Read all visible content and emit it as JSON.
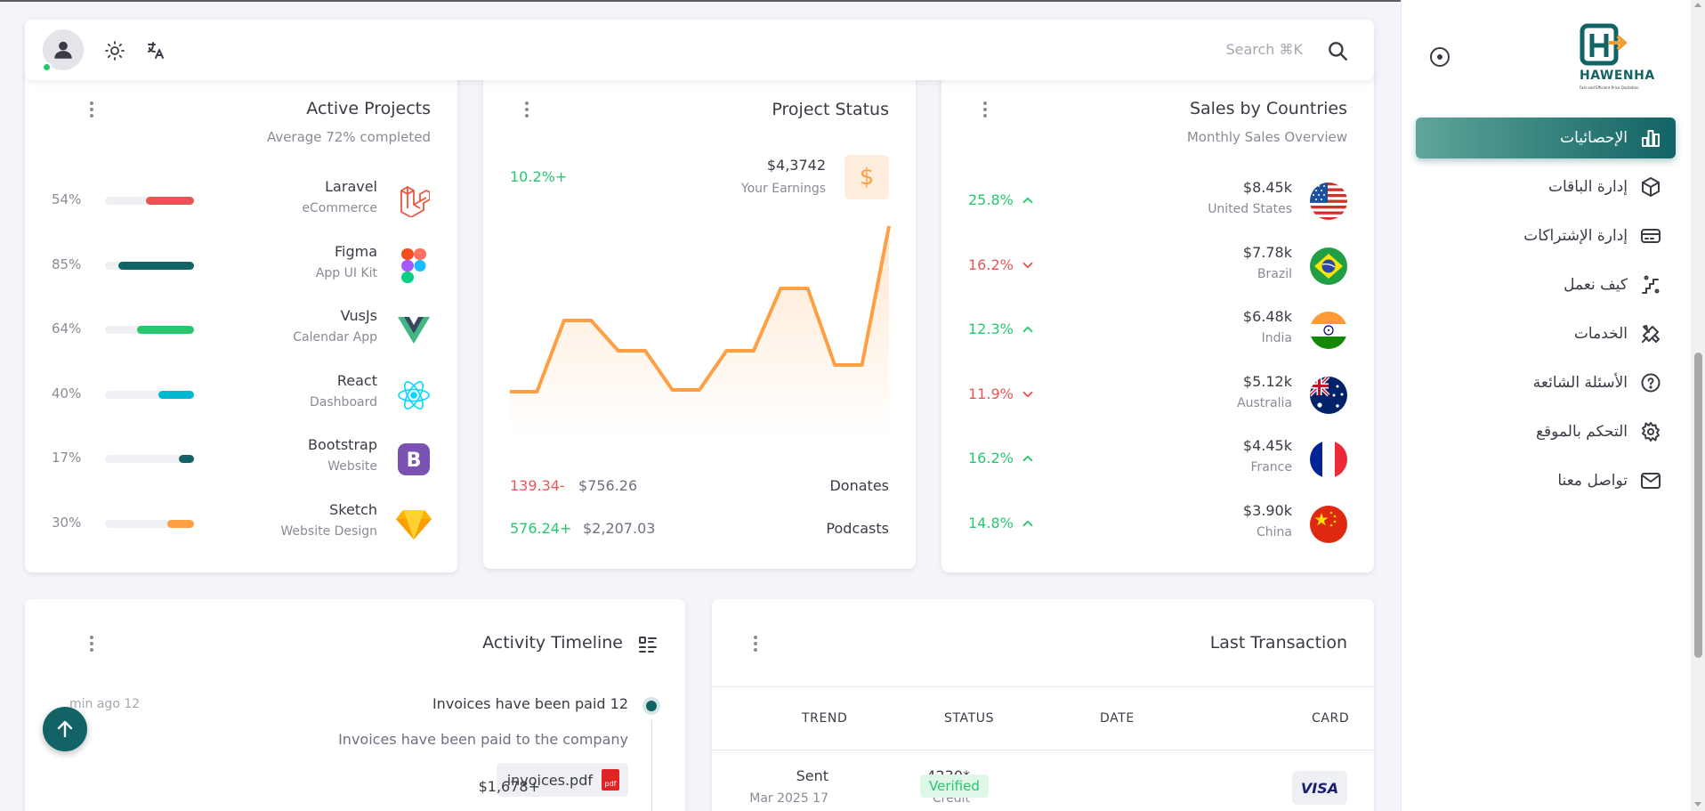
{
  "navbar": {
    "search_placeholder": "Search ⌘K",
    "icons": [
      "user-avatar",
      "sun-icon",
      "translate-icon",
      "search-icon"
    ]
  },
  "active_projects": {
    "title": "Active Projects",
    "subtitle": "Average 72% completed",
    "items": [
      {
        "name": "Laravel",
        "sub": "eCommerce",
        "pct": "54%",
        "progress": 0.54,
        "color": "#ea5455",
        "icon": "laravel-logo"
      },
      {
        "name": "Figma",
        "sub": "App UI Kit",
        "pct": "85%",
        "progress": 0.85,
        "color": "#126365",
        "icon": "figma-logo"
      },
      {
        "name": "VusJs",
        "sub": "Calendar App",
        "pct": "64%",
        "progress": 0.64,
        "color": "#28c76f",
        "icon": "vue-logo"
      },
      {
        "name": "React",
        "sub": "Dashboard",
        "pct": "40%",
        "progress": 0.4,
        "color": "#00bad1",
        "icon": "react-logo"
      },
      {
        "name": "Bootstrap",
        "sub": "Website",
        "pct": "17%",
        "progress": 0.17,
        "color": "#126365",
        "icon": "bootstrap-logo"
      },
      {
        "name": "Sketch",
        "sub": "Website Design",
        "pct": "30%",
        "progress": 0.3,
        "color": "#ff9f43",
        "icon": "sketch-logo"
      }
    ]
  },
  "project_status": {
    "title": "Project Status",
    "change": "10.2%+",
    "earnings_value": "$4,3742",
    "earnings_label": "Your Earnings",
    "rows": [
      {
        "label": "Donates",
        "amount": "$756.26",
        "change": "139.34-",
        "change_color": "#ea5455"
      },
      {
        "label": "Podcasts",
        "amount": "$2,207.03",
        "change": "576.24+",
        "change_color": "#28c76f"
      }
    ]
  },
  "chart_data": {
    "type": "line",
    "title": "",
    "x": [
      0,
      1,
      2,
      3,
      4,
      5,
      6,
      7,
      8,
      9,
      10,
      11,
      12,
      13,
      14
    ],
    "values": [
      5,
      5,
      45,
      45,
      28,
      28,
      6,
      6,
      28,
      28,
      63,
      63,
      20,
      20,
      98
    ],
    "ylim": [
      0,
      100
    ],
    "grid": false,
    "color": "#ff9f43"
  },
  "sales": {
    "title": "Sales by Countries",
    "subtitle": "Monthly Sales Overview",
    "items": [
      {
        "value": "$8.45k",
        "country": "United States",
        "pct": "25.8%",
        "trend": "up",
        "flag": "us-flag"
      },
      {
        "value": "$7.78k",
        "country": "Brazil",
        "pct": "16.2%",
        "trend": "down",
        "flag": "brazil-flag"
      },
      {
        "value": "$6.48k",
        "country": "India",
        "pct": "12.3%",
        "trend": "up",
        "flag": "india-flag"
      },
      {
        "value": "$5.12k",
        "country": "Australia",
        "pct": "11.9%",
        "trend": "down",
        "flag": "australia-flag"
      },
      {
        "value": "$4.45k",
        "country": "France",
        "pct": "16.2%",
        "trend": "up",
        "flag": "france-flag"
      },
      {
        "value": "$3.90k",
        "country": "China",
        "pct": "14.8%",
        "trend": "up",
        "flag": "china-flag"
      }
    ]
  },
  "timeline": {
    "title": "Activity Timeline",
    "event_title": "Invoices have been paid 12",
    "event_time": "min ago 12",
    "event_desc": "Invoices have been paid to the company",
    "attachment": "invoices.pdf",
    "attachment_badge": "pdf"
  },
  "transactions": {
    "title": "Last Transaction",
    "columns": [
      "CARD",
      "DATE",
      "STATUS",
      "TREND"
    ],
    "rows": [
      {
        "card_brand": "VISA",
        "card_number": "4230*",
        "card_type": "Credit",
        "date_label": "Sent",
        "date": "Mar 2025 17",
        "status": "Verified",
        "trend": "$1,678+"
      }
    ]
  },
  "sidebar": {
    "logo_text": "HAWENHA",
    "logo_tagline": "Fast and Efficient Price Quotation",
    "items": [
      {
        "label": "الإحصائيات",
        "icon": "bar-chart-icon",
        "active": true
      },
      {
        "label": "إدارة الباقات",
        "icon": "package-icon",
        "active": false
      },
      {
        "label": "إدارة الإشتراكات",
        "icon": "credit-card-icon",
        "active": false
      },
      {
        "label": "كيف نعمل",
        "icon": "steps-icon",
        "active": false
      },
      {
        "label": "الخدمات",
        "icon": "tools-icon",
        "active": false
      },
      {
        "label": "الأسئلة الشائعة",
        "icon": "help-circle-icon",
        "active": false
      },
      {
        "label": "التحكم بالموقع",
        "icon": "settings-icon",
        "active": false
      },
      {
        "label": "تواصل معنا",
        "icon": "mail-icon",
        "active": false
      }
    ]
  },
  "colors": {
    "primary": "#126365",
    "success": "#28c76f",
    "danger": "#ea5455",
    "warning": "#ff9f43"
  }
}
